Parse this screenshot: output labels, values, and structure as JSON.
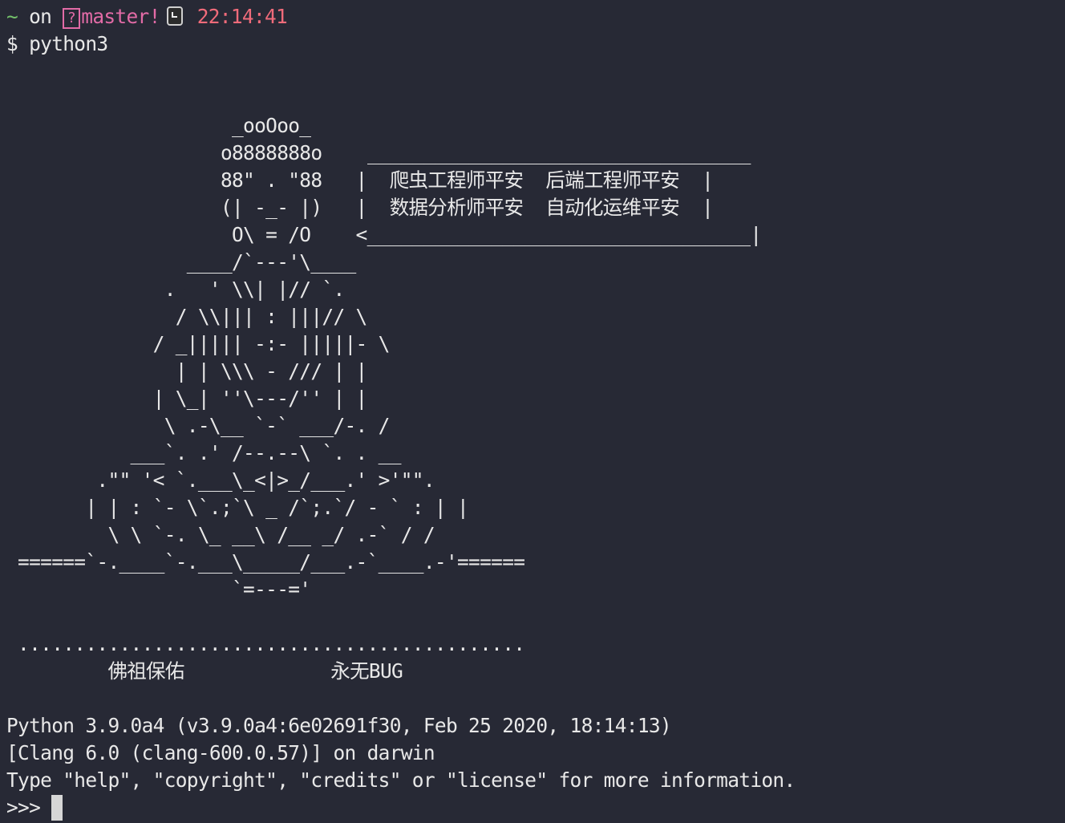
{
  "prompt": {
    "tilde": "~",
    "on": " on ",
    "branch_icon": "?",
    "branch": "master!",
    "clock_icon": "watch-icon",
    "time": "22:14:41",
    "dollar": "$ ",
    "command": "python3"
  },
  "banner": [
    "                    _ooOoo_",
    "                   o8888888o",
    "                   88\" . \"88   |  爬虫工程师平安  后端工程师平安  |",
    "                   (| -_- |)   |  数据分析师平安  自动化运维平安  |",
    "                    O\\ = /O    <__________________________________|",
    "                ____/`---'\\____",
    "              .   ' \\\\| |// `.",
    "               / \\\\||| : |||// \\",
    "             / _||||| -:- |||||- \\",
    "               | | \\\\\\ - /// | |",
    "             | \\_| ''\\---/'' | |",
    "              \\ .-\\__ `-` ___/-. /",
    "           ___`. .' /--.--\\ `. . __",
    "        .\"\" '< `.___\\_<|>_/___.' >'\"\".",
    "       | | : `- \\`.;`\\ _ /`;.`/ - ` : | |",
    "         \\ \\ `-. \\_ __\\ /__ _/ .-` / /",
    " ======`-.____`-.___\\_____/___.-`____.-'======",
    "                    `=---='",
    "",
    " .............................................",
    "         佛祖保佑             永无BUG"
  ],
  "banner_top_rule": "__________________________________",
  "python_info": {
    "version_line": "Python 3.9.0a4 (v3.9.0a4:6e02691f30, Feb 25 2020, 18:14:13)",
    "compiler_line": "[Clang 6.0 (clang-600.0.57)] on darwin",
    "help_line": "Type \"help\", \"copyright\", \"credits\" or \"license\" for more information."
  },
  "repl_prompt": ">>> "
}
